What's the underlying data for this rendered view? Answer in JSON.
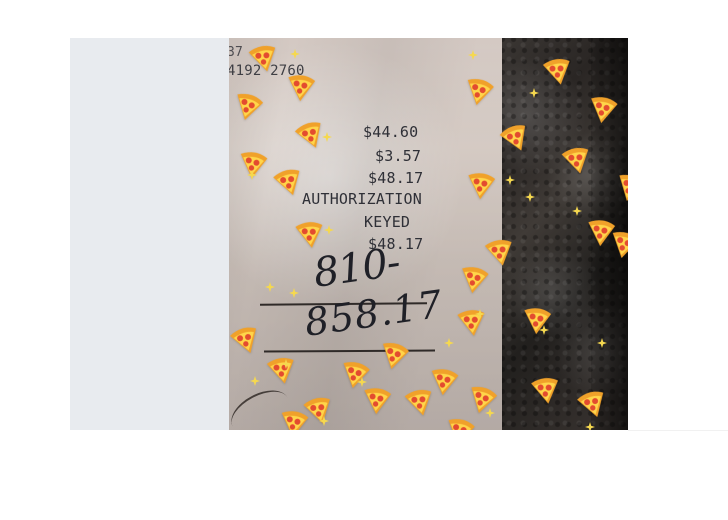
{
  "image": {
    "receipt_text": {
      "partial_top_line_1": "37",
      "partial_top_line_2": "4192 2760",
      "amount_1": "$44.60",
      "amount_2": "$3.57",
      "amount_3": "$48.17",
      "authorization": "AUTHORIZATION",
      "keyed": "KEYED",
      "amount_4": "$48.17",
      "handwritten_tip": "810-",
      "handwritten_total": "858.17"
    },
    "icons": {
      "pizza": "pizza-slice-icon",
      "sparkle": "sparkle-icon"
    },
    "colors": {
      "background": "#ffffff",
      "left_placeholder": "#e8ebef",
      "receipt_paper": "#d8cdc7",
      "receipt_ink": "#2f3037",
      "leather": "#2f2a28",
      "pizza_crust": "#f0a12a",
      "pizza_cheese": "#ffd54a",
      "pizza_pepperoni": "#e34b2f",
      "sparkle": "#f5d84f"
    }
  }
}
